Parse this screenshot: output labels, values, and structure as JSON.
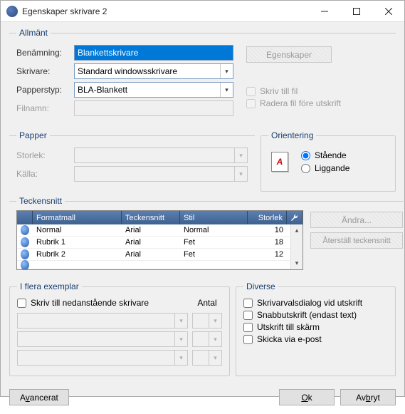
{
  "window": {
    "title": "Egenskaper skrivare 2"
  },
  "allmant": {
    "legend": "Allmänt",
    "ben_label": "Benämning:",
    "ben_value": "Blankettskrivare",
    "skriv_label": "Skrivare:",
    "skriv_value": "Standard windowsskrivare",
    "pap_label": "Papperstyp:",
    "pap_value": "BLA-Blankett",
    "fil_label": "Filnamn:",
    "egensk_btn": "Egenskaper",
    "chk1": "Skriv till fil",
    "chk2": "Radera fil före utskrift"
  },
  "papper": {
    "legend": "Papper",
    "storlek": "Storlek:",
    "kalla": "Källa:"
  },
  "orient": {
    "legend": "Orientering",
    "r1": "Stående",
    "r2": "Liggande",
    "icon_letter": "A"
  },
  "teckensnitt": {
    "legend": "Teckensnitt",
    "headers": {
      "c1": "Formatmall",
      "c2": "Teckensnitt",
      "c3": "Stil",
      "c4": "Storlek"
    },
    "rows": [
      {
        "c1": "Normal",
        "c2": "Arial",
        "c3": "Normal",
        "c4": "10"
      },
      {
        "c1": "Rubrik 1",
        "c2": "Arial",
        "c3": "Fet",
        "c4": "18"
      },
      {
        "c1": "Rubrik 2",
        "c2": "Arial",
        "c3": "Fet",
        "c4": "12"
      }
    ],
    "btn_edit": "Ändra...",
    "btn_reset": "Återställ teckensnitt"
  },
  "exemplar": {
    "legend": "I flera exemplar",
    "chk": "Skriv till nedanstående skrivare",
    "antal": "Antal"
  },
  "diverse": {
    "legend": "Diverse",
    "c1": "Skrivarvalsdialog vid utskrift",
    "c2": "Snabbutskrift (endast text)",
    "c3": "Utskrift till skärm",
    "c4": "Skicka via e-post"
  },
  "footer": {
    "adv_pre": "A",
    "adv_u": "v",
    "adv_post": "ancerat",
    "ok_u": "O",
    "ok_post": "k",
    "cancel_pre": "Av",
    "cancel_u": "b",
    "cancel_post": "ryt"
  }
}
